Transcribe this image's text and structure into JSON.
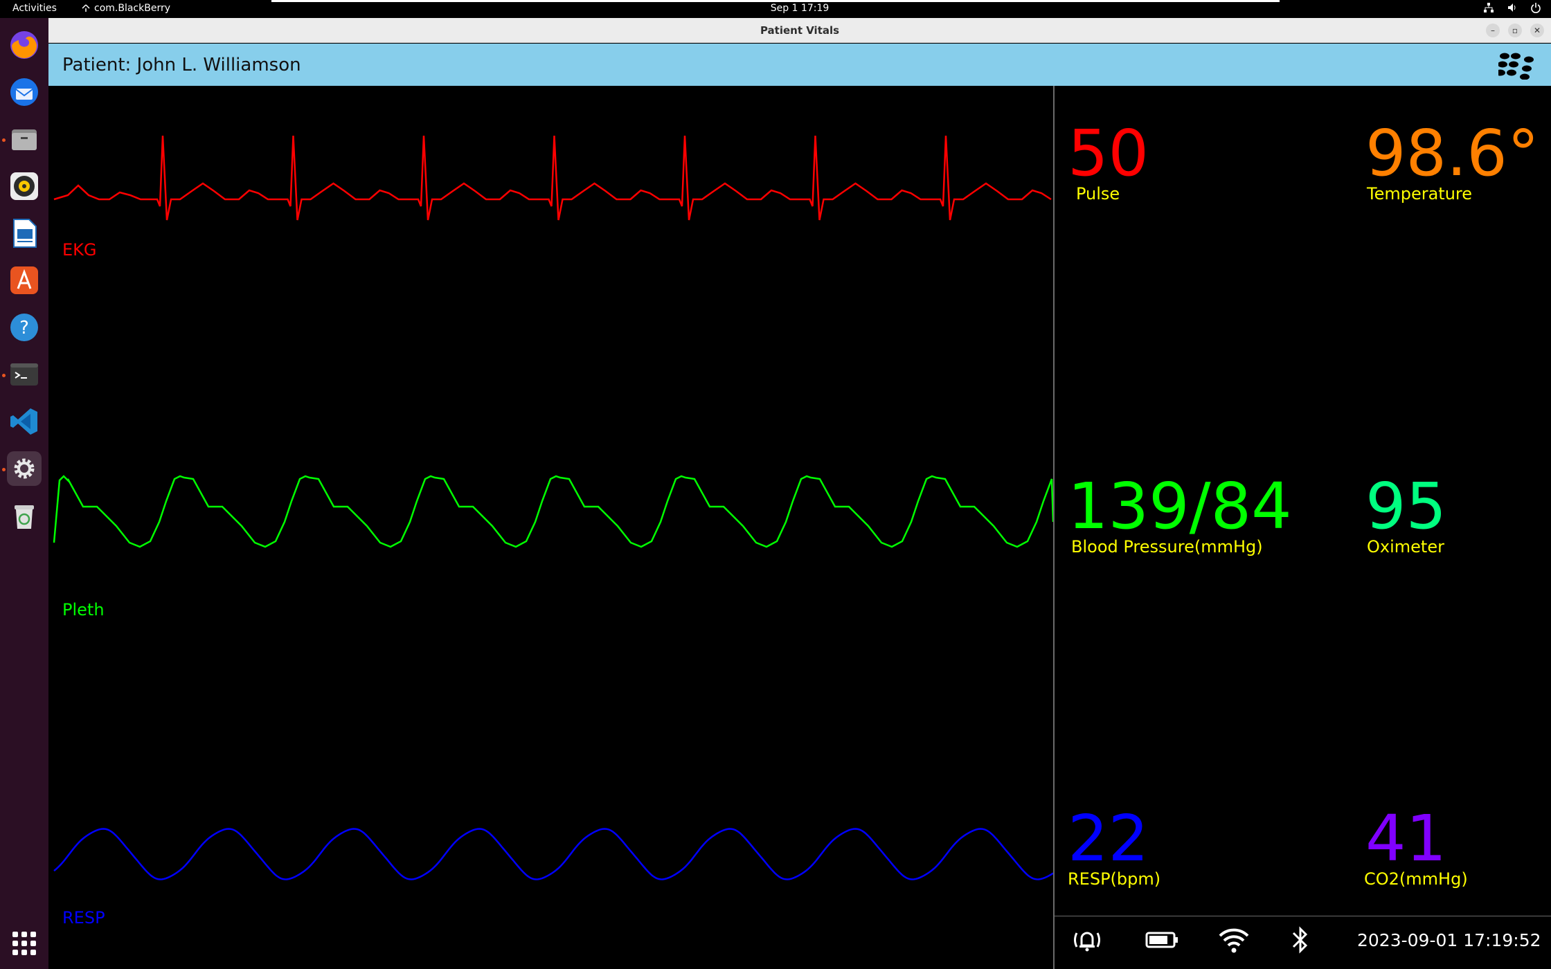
{
  "topbar": {
    "activities": "Activities",
    "app_name": "com.BlackBerry",
    "clock": "Sep 1  17:19"
  },
  "dock": {
    "items": [
      "firefox-icon",
      "thunderbird-icon",
      "files-icon",
      "rhythmbox-icon",
      "writer-icon",
      "app-center-icon",
      "help-icon",
      "terminal-icon",
      "vscode-icon",
      "settings-icon",
      "trash-icon"
    ],
    "show_apps": "show-apps-icon"
  },
  "window": {
    "title": "Patient Vitals",
    "patient": "Patient: John L. Williamson"
  },
  "waves": {
    "ekg_label": "EKG",
    "pleth_label": "Pleth",
    "resp_label": "RESP",
    "ekg_color": "#ff0000",
    "pleth_color": "#00ff00",
    "resp_color": "#0000ff"
  },
  "vitals": {
    "pulse": {
      "value": "50",
      "label": "Pulse",
      "color": "#ff0000"
    },
    "temperature": {
      "value": "98.6°",
      "label": "Temperature",
      "color": "#ff8000"
    },
    "bp": {
      "value": "139/84",
      "label": "Blood Pressure(mmHg)",
      "color": "#00ff00"
    },
    "oximeter": {
      "value": "95",
      "label": "Oximeter",
      "color": "#00ff80"
    },
    "resp": {
      "value": "22",
      "label": "RESP(bpm)",
      "color": "#0000ff"
    },
    "co2": {
      "value": "41",
      "label": "CO2(mmHg)",
      "color": "#8000ff"
    },
    "label_color": "#ffff00"
  },
  "statusbar": {
    "icons": [
      "alarm-icon",
      "battery-icon",
      "wifi-icon",
      "bluetooth-icon"
    ],
    "datetime": "2023-09-01 17:19:52"
  }
}
